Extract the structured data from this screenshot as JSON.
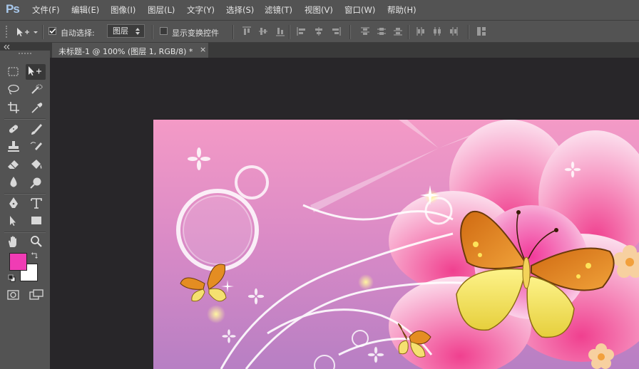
{
  "app": {
    "logo_text": "Ps"
  },
  "menubar": {
    "items": [
      "文件(F)",
      "编辑(E)",
      "图像(I)",
      "图层(L)",
      "文字(Y)",
      "选择(S)",
      "滤镜(T)",
      "视图(V)",
      "窗口(W)",
      "帮助(H)"
    ]
  },
  "options": {
    "auto_select_label": "自动选择:",
    "auto_select_checked": true,
    "auto_select_target": "图层",
    "show_transform_label": "显示变换控件",
    "show_transform_checked": false
  },
  "document": {
    "tab_title": "未标题-1 @ 100% (图层 1, RGB/8) *",
    "close_glyph": "×"
  },
  "tools": {
    "foreground_color": "#f03cb4",
    "background_color": "#ffffff"
  },
  "icons": [
    "move-tool-icon",
    "marquee-tool-icon",
    "lasso-tool-icon",
    "quick-select-tool-icon",
    "crop-tool-icon",
    "eyedropper-tool-icon",
    "healing-brush-icon",
    "brush-tool-icon",
    "clone-stamp-icon",
    "history-brush-icon",
    "eraser-tool-icon",
    "paint-bucket-icon",
    "blur-tool-icon",
    "dodge-tool-icon",
    "pen-tool-icon",
    "type-tool-icon",
    "path-select-icon",
    "rectangle-tool-icon",
    "hand-tool-icon",
    "zoom-tool-icon",
    "quick-mask-icon",
    "screen-mode-icon"
  ]
}
